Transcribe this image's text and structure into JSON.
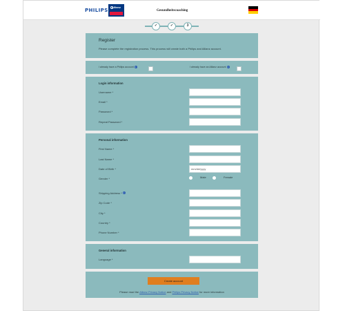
{
  "header": {
    "philips_logo": "PHILIPS",
    "allianz_logo": "Allianz",
    "title": "Gesundheitscoaching",
    "flag_colors": [
      "#000000",
      "#dd0000",
      "#ffce00"
    ]
  },
  "steps": [
    {
      "icon": "check-icon",
      "label": "✓"
    },
    {
      "icon": "check-icon",
      "label": "✓"
    },
    {
      "label": "3"
    }
  ],
  "register": {
    "title": "Register",
    "description": "Please complete the registration process. This process will create both a Philips and Allianz account."
  },
  "checks": {
    "philips_label": "I already have a Philips account",
    "allianz_label": "I already have an Allianz account"
  },
  "login": {
    "section_title": "Login information",
    "username_label": "Username *",
    "email_label": "Email *",
    "password_label": "Password *",
    "repeat_password_label": "Repeat Password *"
  },
  "personal": {
    "section_title": "Personal information",
    "first_name_label": "First Name *",
    "last_name_label": "Last Name *",
    "dob_label": "Date of Birth *",
    "dob_placeholder": "mm/dd/yyyy",
    "gender_label": "Gender *",
    "male_label": "Male",
    "female_label": "Female",
    "shipping_label": "Shipping Address *",
    "zip_label": "Zip Code *",
    "city_label": "City *",
    "country_label": "Country *",
    "phone_label": "Phone Number *"
  },
  "general": {
    "section_title": "General information",
    "language_label": "Language *"
  },
  "submit": {
    "button_label": "Create account",
    "footer_prefix": "Please read the",
    "allianz_link": "Allianz Privacy Notice",
    "and_text": "and",
    "philips_link": "Philips Privacy Notice",
    "footer_suffix": "for more information"
  }
}
